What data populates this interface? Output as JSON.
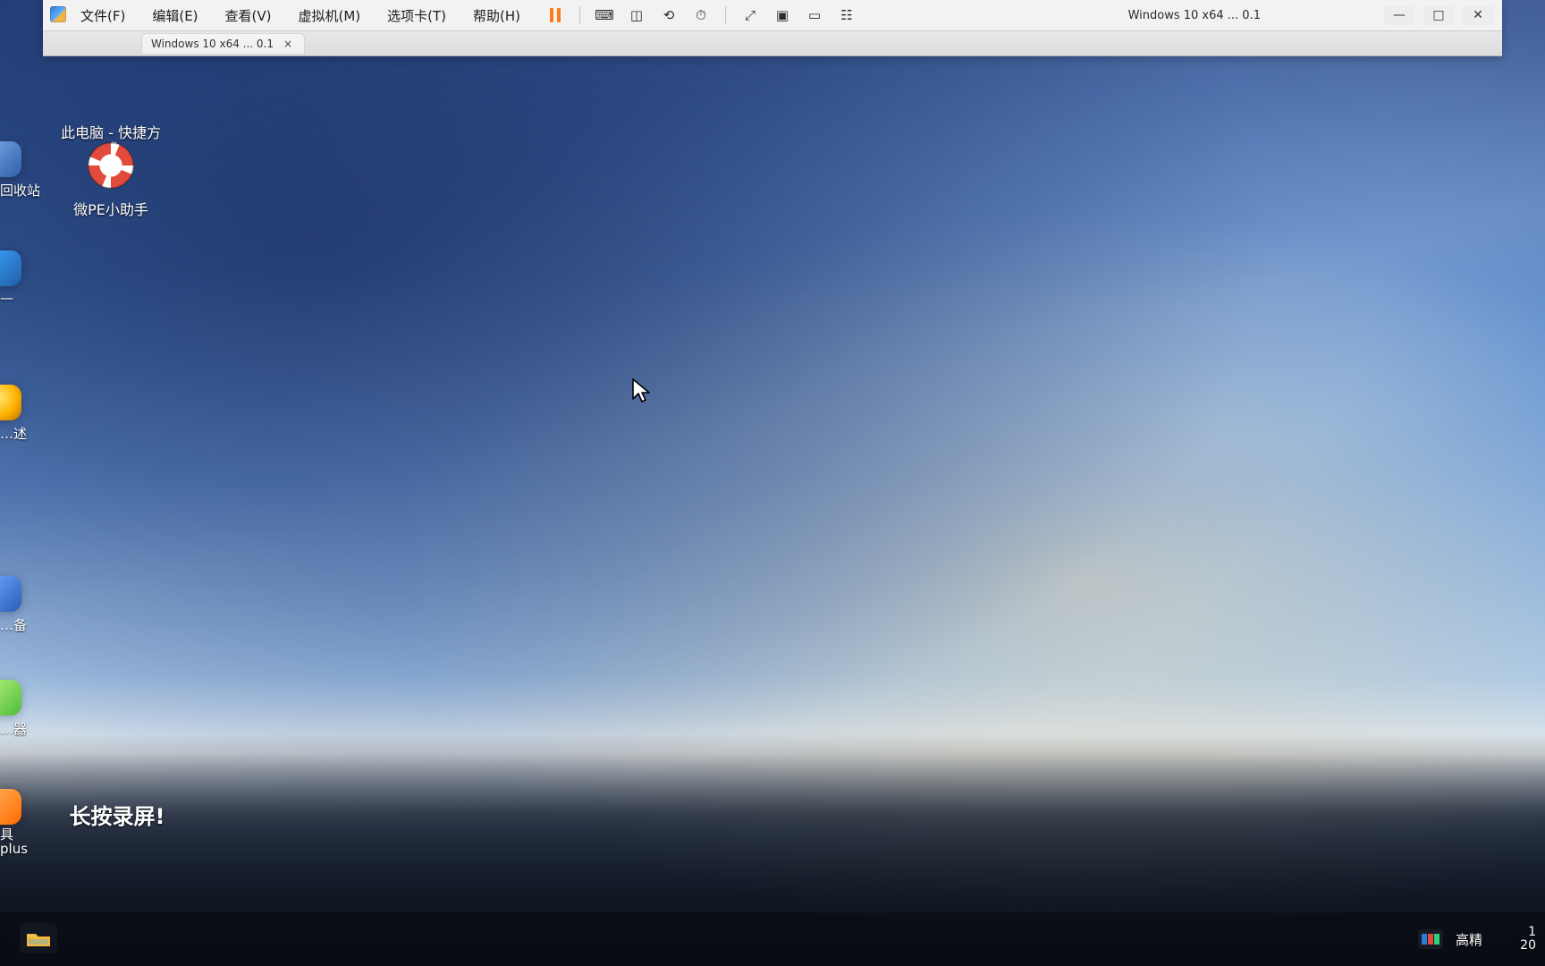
{
  "vm": {
    "menu": [
      "文件(F)",
      "编辑(E)",
      "查看(V)",
      "虚拟机(M)",
      "选项卡(T)",
      "帮助(H)"
    ],
    "title_partial": "Windows 10 x64 ... 0.1"
  },
  "desktop": {
    "icons": [
      {
        "name": "desktop-icon-1",
        "label": "此电脑 - 快捷方式"
      },
      {
        "name": "desktop-icon-2",
        "label": "微PE小助手"
      },
      {
        "name": "desktop-icon-3",
        "label": "长按录屏!"
      }
    ],
    "left_partials": [
      {
        "name": "left-partial-1",
        "label": "回收站"
      },
      {
        "name": "left-partial-2",
        "label": "—"
      },
      {
        "name": "left-partial-3",
        "label": "…述"
      },
      {
        "name": "left-partial-4",
        "label": "…备"
      },
      {
        "name": "left-partial-5",
        "label": "…器"
      },
      {
        "name": "left-partial-6",
        "label": "具\nplus"
      }
    ]
  },
  "taskbar": {
    "tray_label": "高精",
    "clock_time": "1",
    "clock_date": "20"
  },
  "colors": {
    "accent_orange": "#ff7a1a",
    "menu_text": "#1b1b1b"
  }
}
